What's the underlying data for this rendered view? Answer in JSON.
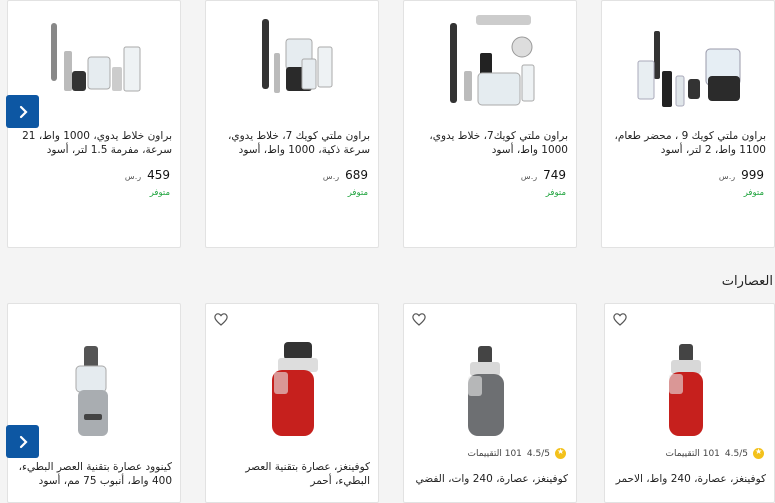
{
  "blenders": [
    {
      "title": "براون ملتي كويك 9 ، محضر طعام، 1100 واط، 2 لتر، أسود",
      "price": "999",
      "currency": "ر.س",
      "stock": "متوفر"
    },
    {
      "title": "براون ملتي كويك7، خلاط يدوي، 1000 واط، أسود",
      "price": "749",
      "currency": "ر.س",
      "stock": "متوفر"
    },
    {
      "title": "براون ملتي كويك 7، خلاط يدوي، سرعة ذكية، 1000 واط، أسود",
      "price": "689",
      "currency": "ر.س",
      "stock": "متوفر"
    },
    {
      "title": "براون خلاط يدوي، 1000 واط، 21 سرعة، مفرمة 1.5 لتر، أسود",
      "price": "459",
      "currency": "ر.س",
      "stock": "متوفر"
    }
  ],
  "section_title": "العصارات",
  "juicers": [
    {
      "title": "كوفينغز، عصارة، 240 واط، الاحمر",
      "rating": "4.5/5",
      "reviews": "101 التقييمات"
    },
    {
      "title": "كوفينغز، عصارة، 240 وات، الفضي",
      "rating": "4.5/5",
      "reviews": "101 التقييمات"
    },
    {
      "title": "كوفينغز، عصارة بتقنية العصر البطيء، أحمر"
    },
    {
      "title": "كينوود عصارة بتقنية العصر البطيء، 400 واط، أنبوب 75 مم، أسود"
    }
  ],
  "colors": {
    "accent": "#0d57a3",
    "in_stock": "#1ea33d",
    "star": "#f3c11b"
  }
}
